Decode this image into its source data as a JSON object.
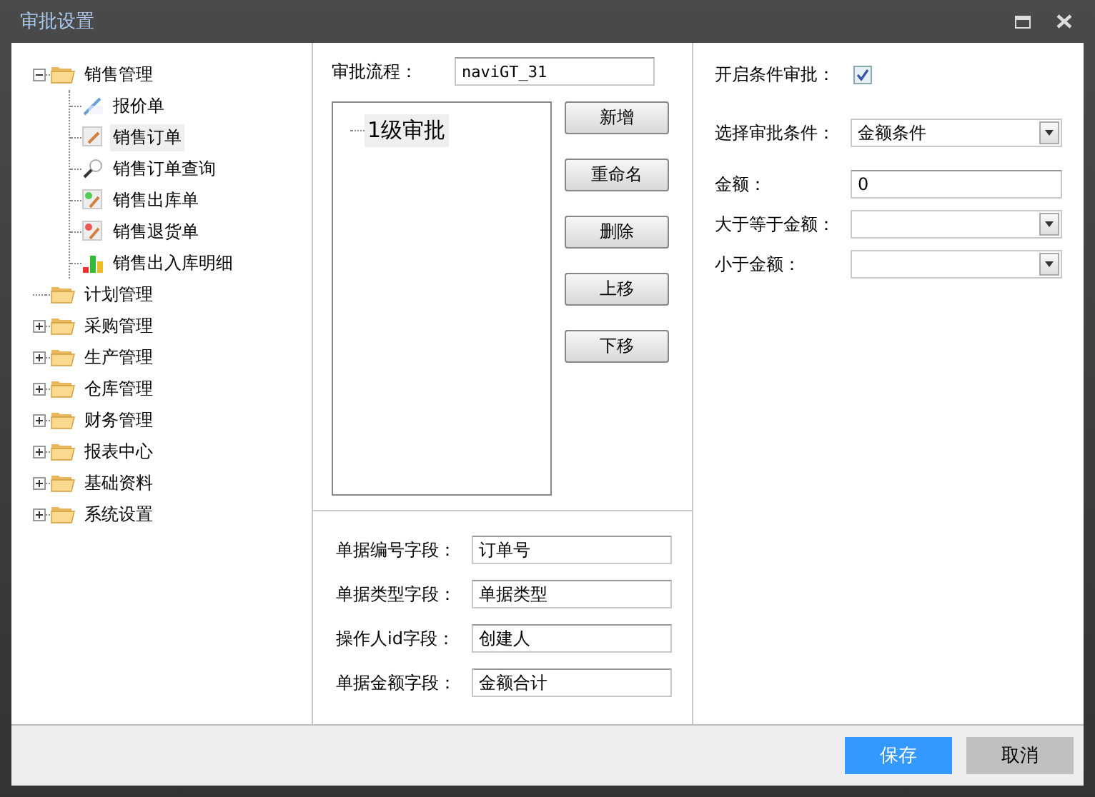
{
  "window": {
    "title": "审批设置"
  },
  "tree": [
    {
      "label": "销售管理",
      "kind": "branch",
      "expanded": true,
      "children": [
        {
          "label": "报价单",
          "kind": "quote",
          "selected": false
        },
        {
          "label": "销售订单",
          "kind": "order",
          "selected": true
        },
        {
          "label": "销售订单查询",
          "kind": "search",
          "selected": false
        },
        {
          "label": "销售出库单",
          "kind": "outbound",
          "selected": false
        },
        {
          "label": "销售退货单",
          "kind": "return",
          "selected": false
        },
        {
          "label": "销售出入库明细",
          "kind": "chart",
          "selected": false
        }
      ]
    },
    {
      "label": "计划管理",
      "kind": "plain"
    },
    {
      "label": "采购管理",
      "kind": "branch",
      "expanded": false
    },
    {
      "label": "生产管理",
      "kind": "branch",
      "expanded": false
    },
    {
      "label": "仓库管理",
      "kind": "branch",
      "expanded": false
    },
    {
      "label": "财务管理",
      "kind": "branch",
      "expanded": false
    },
    {
      "label": "报表中心",
      "kind": "branch",
      "expanded": false
    },
    {
      "label": "基础资料",
      "kind": "branch",
      "expanded": false
    },
    {
      "label": "系统设置",
      "kind": "branch",
      "expanded": false
    }
  ],
  "flow": {
    "label": "审批流程：",
    "value": "naviGT_31",
    "steps": [
      {
        "label": "1级审批",
        "selected": true
      }
    ],
    "buttons": [
      "新增",
      "重命名",
      "删除",
      "上移",
      "下移"
    ]
  },
  "fields": [
    {
      "label": "单据编号字段：",
      "value": "订单号"
    },
    {
      "label": "单据类型字段：",
      "value": "单据类型"
    },
    {
      "label": "操作人id字段：",
      "value": "创建人"
    },
    {
      "label": "单据金额字段：",
      "value": "金额合计"
    }
  ],
  "conditions": {
    "enable": {
      "label": "开启条件审批：",
      "checked": true
    },
    "rows": [
      {
        "kind": "select",
        "label": "选择审批条件：",
        "value": "金额条件"
      },
      {
        "kind": "input",
        "label": "金额：",
        "value": "0"
      },
      {
        "kind": "select",
        "label": "大于等于金额："
      },
      {
        "kind": "select",
        "label": "小于金额："
      }
    ]
  },
  "footer": {
    "buttons": [
      {
        "label": "保存",
        "primary": true
      },
      {
        "label": "取消",
        "primary": false
      }
    ]
  }
}
